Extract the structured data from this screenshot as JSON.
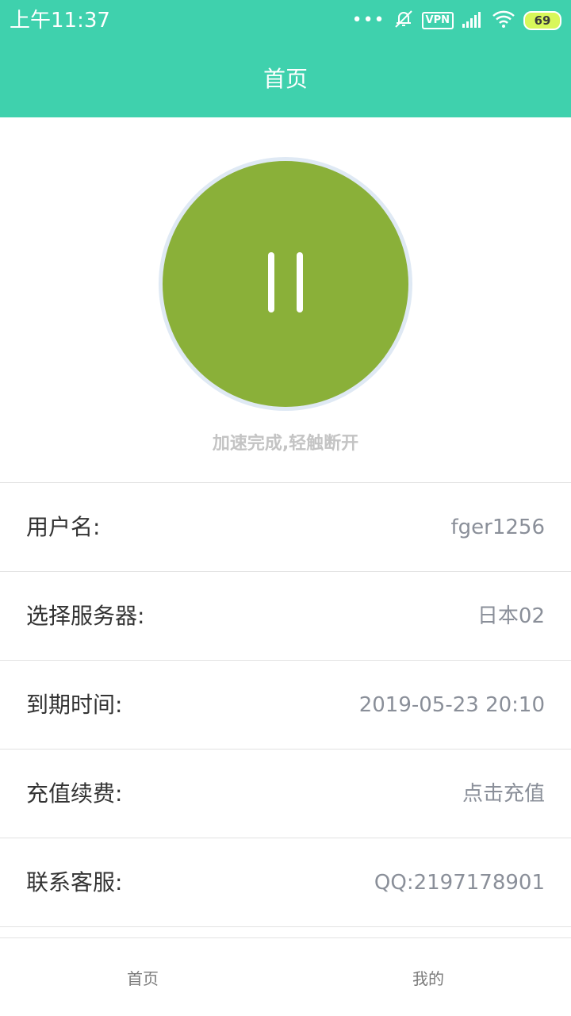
{
  "status_bar": {
    "time": "上午11:37",
    "dots": "•••",
    "vpn": "VPN",
    "battery": "69"
  },
  "header": {
    "title": "首页"
  },
  "connect": {
    "caption": "加速完成,轻触断开"
  },
  "info": {
    "rows": [
      {
        "label": "用户名:",
        "value": "fger1256"
      },
      {
        "label": "选择服务器:",
        "value": "日本02"
      },
      {
        "label": "到期时间:",
        "value": "2019-05-23 20:10"
      },
      {
        "label": "充值续费:",
        "value": "点击充值"
      },
      {
        "label": "联系客服:",
        "value": "QQ:2197178901"
      }
    ]
  },
  "nav": {
    "tabs": [
      {
        "label": "首页"
      },
      {
        "label": "我的"
      }
    ]
  },
  "colors": {
    "accent": "#3fd1ad",
    "connect_button": "#8ab039"
  },
  "icons": [
    "mute-icon",
    "signal-icon",
    "wifi-icon",
    "battery-icon",
    "pause-icon"
  ]
}
